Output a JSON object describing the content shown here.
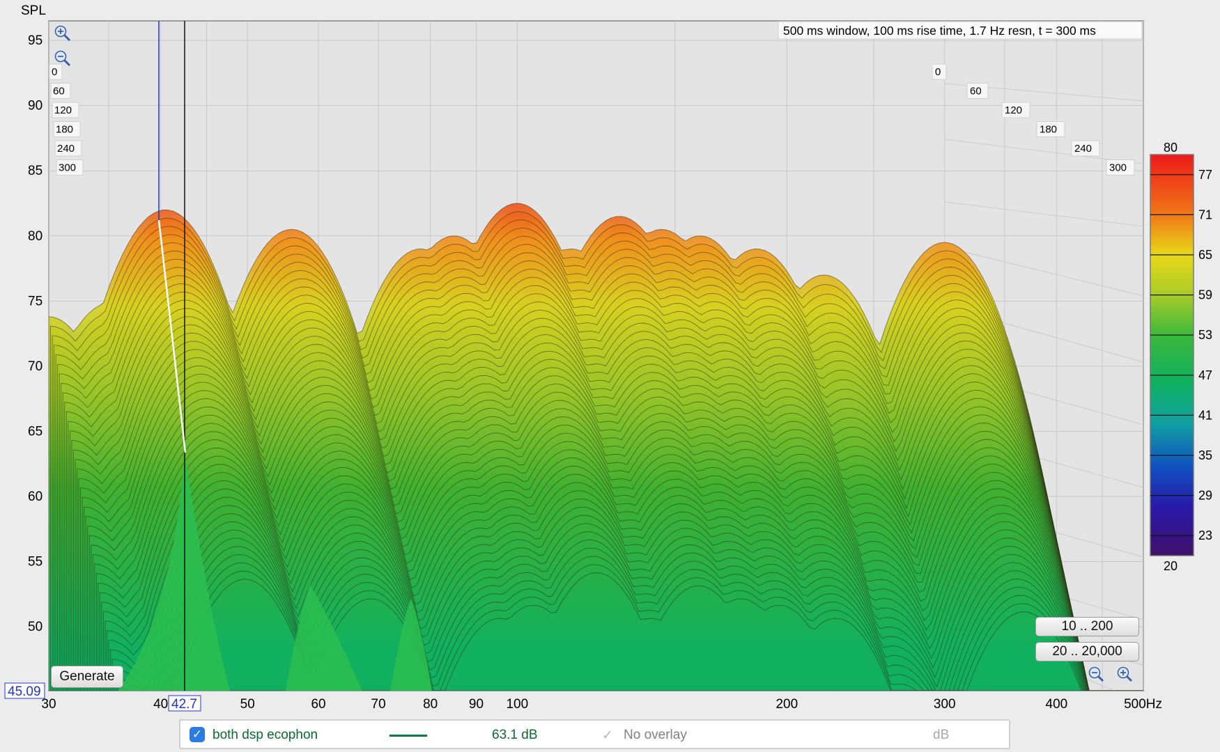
{
  "chart_data": {
    "type": "area",
    "title": "",
    "annotation": "500 ms window, 100 ms rise time,  1.7 Hz resn, t = 300 ms",
    "ylabel": "SPL",
    "xunit": "Hz",
    "y_ticks": [
      "95",
      "90",
      "85",
      "80",
      "75",
      "70",
      "65",
      "60",
      "55",
      "50"
    ],
    "ylim": [
      45.09,
      96.5
    ],
    "x_ticks": [
      "30",
      "40",
      "50",
      "60",
      "70",
      "80",
      "90",
      "100",
      "200",
      "300",
      "400",
      "500Hz"
    ],
    "x_tick_values": [
      30,
      40,
      50,
      60,
      70,
      80,
      90,
      100,
      200,
      300,
      400,
      500
    ],
    "xlim": [
      30,
      500
    ],
    "x_scale": "log",
    "time_ticks": [
      "0",
      "60",
      "120",
      "180",
      "240",
      "300"
    ],
    "time_unit": "ms",
    "cursor_y_value": "45.09",
    "cursor_x_value": "42.7",
    "colorbar": {
      "min": "20",
      "max": "80",
      "ticks": [
        "77",
        "71",
        "65",
        "59",
        "53",
        "47",
        "41",
        "35",
        "29",
        "23"
      ],
      "colors": [
        "#ee1a1a",
        "#f07818",
        "#e8d818",
        "#a8cc28",
        "#3cb83c",
        "#10b060",
        "#10a0a0",
        "#1050c0",
        "#2818a8",
        "#40106a"
      ]
    },
    "peaks_at_t0": [
      {
        "x": 30,
        "y": 73.8
      },
      {
        "x": 35,
        "y": 74.8
      },
      {
        "x": 37,
        "y": 72
      },
      {
        "x": 40.5,
        "y": 82
      },
      {
        "x": 44,
        "y": 76
      },
      {
        "x": 47,
        "y": 72
      },
      {
        "x": 51,
        "y": 70
      },
      {
        "x": 56,
        "y": 80.5
      },
      {
        "x": 60,
        "y": 72
      },
      {
        "x": 65,
        "y": 70
      },
      {
        "x": 72,
        "y": 71
      },
      {
        "x": 78,
        "y": 79
      },
      {
        "x": 85,
        "y": 80
      },
      {
        "x": 100,
        "y": 82.5
      },
      {
        "x": 115,
        "y": 79
      },
      {
        "x": 130,
        "y": 81.5
      },
      {
        "x": 145,
        "y": 80.5
      },
      {
        "x": 160,
        "y": 80
      },
      {
        "x": 185,
        "y": 79
      },
      {
        "x": 220,
        "y": 77
      },
      {
        "x": 300,
        "y": 79.5
      }
    ],
    "series": [
      {
        "name": "both dsp ecophon",
        "value_label": "63.1 dB",
        "color": "#0a7a3a"
      }
    ],
    "grid": true
  },
  "toolbar": {
    "zoom_in_icon": "zoom-in-icon",
    "zoom_out_icon": "zoom-out-icon",
    "generate_label": "Generate",
    "range1_label": "10 .. 200",
    "range2_label": "20 .. 20,000"
  },
  "legend": {
    "series_label": "both dsp ecophon",
    "series_value": "63.1 dB",
    "overlay_label": "No overlay",
    "unit_label": "dB",
    "checked": true
  }
}
